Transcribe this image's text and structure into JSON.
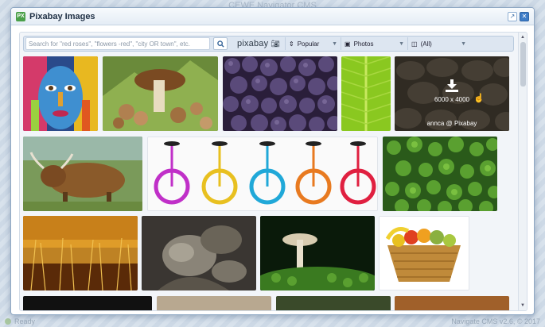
{
  "background": {
    "app_title": "CEWE Navigator CMS",
    "status_left": "Ready",
    "status_right": "Navigate CMS v2.6, © 2017"
  },
  "dialog": {
    "title": "Pixabay Images"
  },
  "toolbar": {
    "search_placeholder": "Search for \"red roses\", \"flowers -red\", \"city OR town\", etc.",
    "logo_text": "pixabay",
    "order": "Popular",
    "type": "Photos",
    "orientation": "(All)"
  },
  "hover": {
    "resolution": "6000 x 4000",
    "credit": "annca @ Pixabay"
  },
  "colors": {
    "accent": "#3d7cc7",
    "frame": "#8fa8c4"
  }
}
